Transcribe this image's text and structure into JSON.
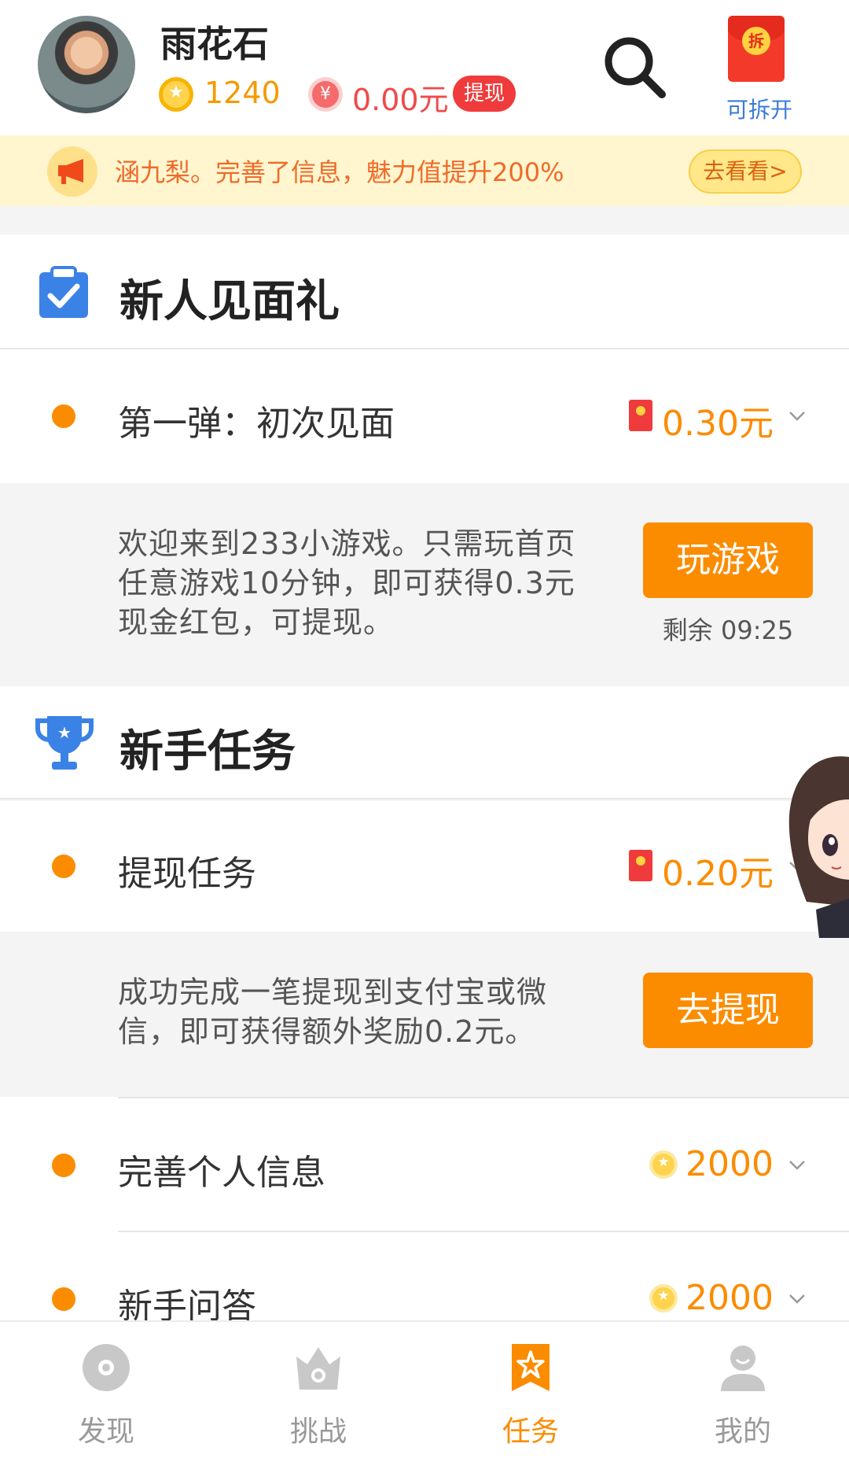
{
  "header": {
    "username": "雨花石",
    "coins": "1240",
    "cash": "0.00元",
    "withdraw_badge": "提现",
    "redpack_seal": "拆",
    "redpack_label": "可拆开"
  },
  "notice": {
    "text": "涵九梨。完善了信息，魅力值提升200%",
    "button": "去看看>"
  },
  "sections": [
    {
      "title": "新人见面礼",
      "tasks": [
        {
          "name": "第一弹：初次见面",
          "reward": "0.30元",
          "reward_type": "red-envelope",
          "desc": "欢迎来到233小游戏。只需玩首页任意游戏10分钟，即可获得0.3元现金红包，可提现。",
          "action": "玩游戏",
          "timer": "剩余 09:25"
        }
      ]
    },
    {
      "title": "新手任务",
      "tasks": [
        {
          "name": "提现任务",
          "reward": "0.20元",
          "reward_type": "red-envelope",
          "desc": "成功完成一笔提现到支付宝或微信，即可获得额外奖励0.2元。",
          "action": "去提现"
        },
        {
          "name": "完善个人信息",
          "reward": "2000",
          "reward_type": "coin"
        },
        {
          "name": "新手问答",
          "reward": "2000",
          "reward_type": "coin"
        }
      ]
    }
  ],
  "nav": [
    {
      "label": "发现",
      "icon": "disc-icon"
    },
    {
      "label": "挑战",
      "icon": "crown-icon"
    },
    {
      "label": "任务",
      "icon": "task-star-icon",
      "active": true
    },
    {
      "label": "我的",
      "icon": "user-icon"
    }
  ],
  "colors": {
    "accent": "#fb8c00",
    "notice_bg": "#fff6cf",
    "red": "#ef3b3b",
    "link_blue": "#3a7bd5"
  }
}
